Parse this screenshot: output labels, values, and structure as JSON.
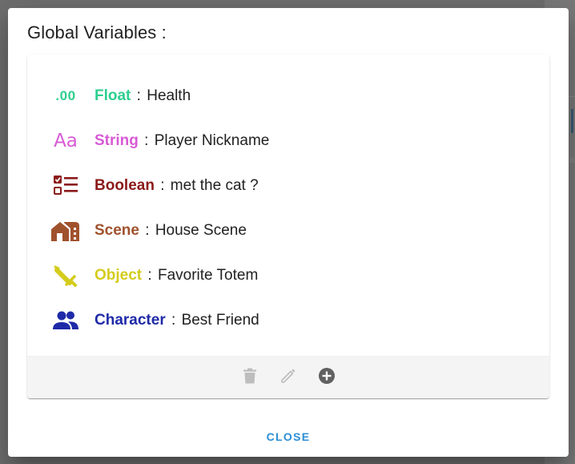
{
  "dialog": {
    "title": "Global Variables :",
    "close_label": "CLOSE"
  },
  "variables": [
    {
      "type": "Float",
      "separator": ":",
      "name": "Health",
      "color": "#2ecf8f",
      "icon": "float-decimal-icon",
      "glyph": ".00"
    },
    {
      "type": "String",
      "separator": ":",
      "name": "Player Nickname",
      "color": "#d85ad6",
      "icon": "text-aa-icon",
      "glyph": "Aa"
    },
    {
      "type": "Boolean",
      "separator": ":",
      "name": "met the cat ?",
      "color": "#8b1a1a",
      "icon": "checklist-icon"
    },
    {
      "type": "Scene",
      "separator": ":",
      "name": "House Scene",
      "color": "#a0522d",
      "icon": "house-icon"
    },
    {
      "type": "Object",
      "separator": ":",
      "name": "Favorite Totem",
      "color": "#d4cc1c",
      "icon": "sword-icon"
    },
    {
      "type": "Character",
      "separator": ":",
      "name": "Best Friend",
      "color": "#1f2aa8",
      "icon": "people-icon"
    }
  ],
  "toolbar": {
    "delete_icon": "trash-icon",
    "edit_icon": "pencil-icon",
    "add_icon": "add-circle-icon",
    "disabled_color": "#bdbdbd",
    "active_color": "#616161"
  },
  "colors": {
    "accent": "#2c8fd6"
  }
}
